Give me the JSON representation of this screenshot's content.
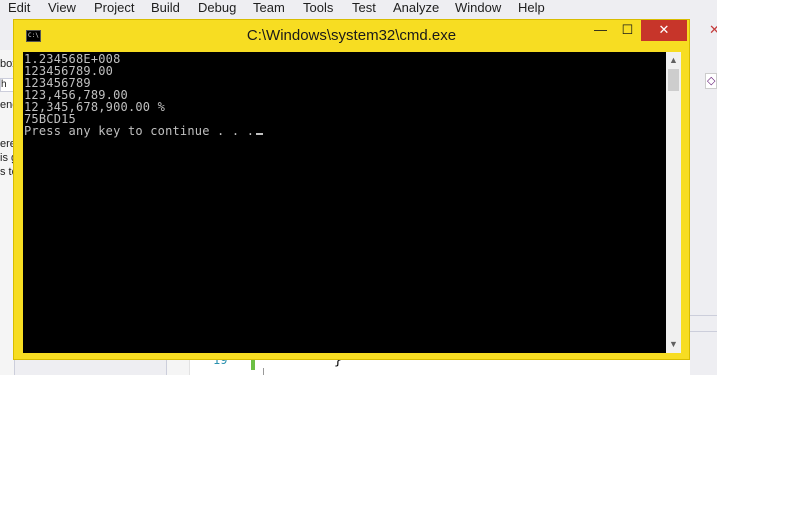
{
  "vs": {
    "menu": [
      "Edit",
      "View",
      "Project",
      "Build",
      "Debug",
      "Team",
      "Tools",
      "Test",
      "Analyze",
      "Window",
      "Help"
    ],
    "left_panel_fragments": [
      "box",
      "h T",
      "ene",
      "ere",
      "is g",
      "s te"
    ],
    "editor": {
      "line_number": "19",
      "brace": "}"
    }
  },
  "cmd": {
    "title": "C:\\Windows\\system32\\cmd.exe",
    "icon_label": "C:\\.",
    "buttons": {
      "minimize": "—",
      "maximize": "☐",
      "close": "✕"
    },
    "output_lines": [
      "1.234568E+008",
      "123456789.00",
      "123456789",
      "123,456,789.00",
      "12,345,678,900.00 %",
      "75BCD15",
      "Press any key to continue . . ."
    ],
    "scroll": {
      "up": "▲",
      "down": "▼"
    }
  },
  "colors": {
    "cmd_frame": "#f7dd22",
    "close_button": "#c7352a",
    "console_bg": "#000000",
    "console_text": "#c0c0c0"
  }
}
